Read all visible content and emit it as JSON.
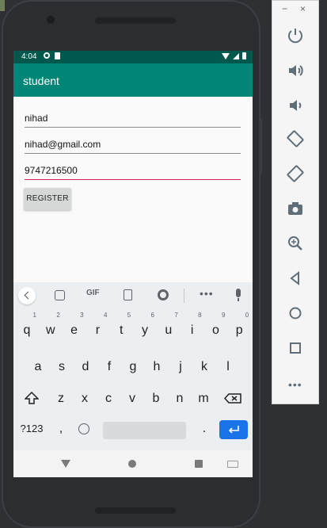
{
  "device": {
    "status_bar": {
      "time": "4:04"
    },
    "app_bar": {
      "title": "student"
    }
  },
  "form": {
    "name_value": "nihad",
    "email_value": "nihad@gmail.com",
    "phone_value": "9747216500",
    "register_label": "REGISTER"
  },
  "keyboard": {
    "toolbar": {
      "gif_label": "GIF",
      "more_label": "•••"
    },
    "row1": [
      {
        "k": "q",
        "n": "1"
      },
      {
        "k": "w",
        "n": "2"
      },
      {
        "k": "e",
        "n": "3"
      },
      {
        "k": "r",
        "n": "4"
      },
      {
        "k": "t",
        "n": "5"
      },
      {
        "k": "y",
        "n": "6"
      },
      {
        "k": "u",
        "n": "7"
      },
      {
        "k": "i",
        "n": "8"
      },
      {
        "k": "o",
        "n": "9"
      },
      {
        "k": "p",
        "n": "0"
      }
    ],
    "row2": [
      "a",
      "s",
      "d",
      "f",
      "g",
      "h",
      "j",
      "k",
      "l"
    ],
    "row3": [
      "z",
      "x",
      "c",
      "v",
      "b",
      "n",
      "m"
    ],
    "row4": {
      "symbols_label": "?123",
      "comma_label": ",",
      "period_label": "."
    }
  },
  "emulator_panel": {
    "minimize_label": "−",
    "close_label": "×",
    "more_label": "•••",
    "icons": [
      "power-icon",
      "volume-up-icon",
      "volume-down-icon",
      "rotate-left-icon",
      "rotate-right-icon",
      "camera-icon",
      "zoom-icon",
      "back-icon",
      "home-icon",
      "overview-icon"
    ]
  },
  "colors": {
    "status_bar": "#00574b",
    "app_bar": "#008577",
    "accent": "#d81b60",
    "enter_key": "#1a73e8"
  }
}
